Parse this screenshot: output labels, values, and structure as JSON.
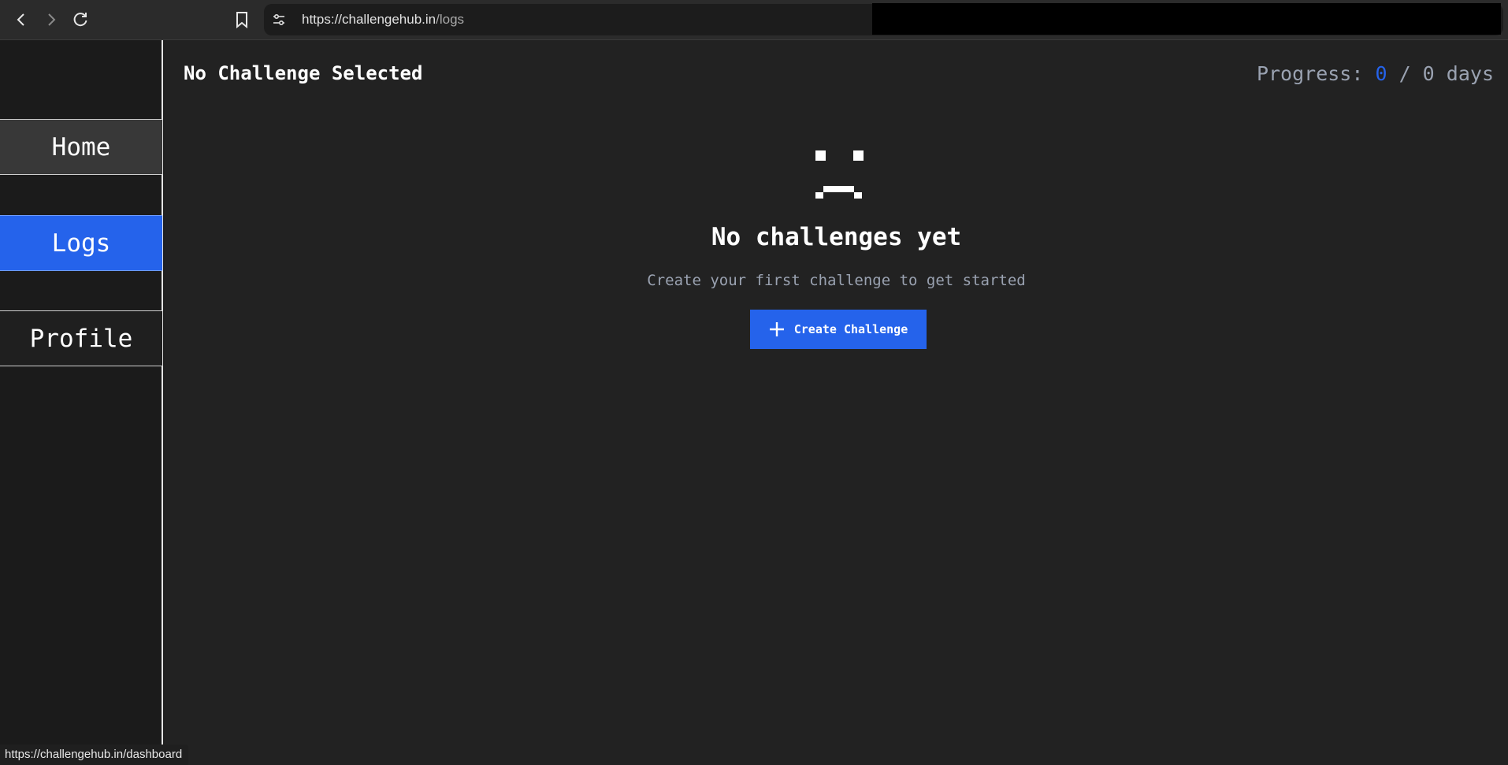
{
  "browser": {
    "url_host": "https://challengehub.in",
    "url_path": "/logs",
    "icons": [
      "back-icon",
      "forward-icon",
      "reload-icon",
      "bookmark-icon",
      "site-info-icon"
    ]
  },
  "sidebar": {
    "items": [
      {
        "label": "Home",
        "active": false
      },
      {
        "label": "Logs",
        "active": true
      },
      {
        "label": "Profile",
        "active": false
      }
    ]
  },
  "header": {
    "title": "No Challenge Selected",
    "progress_label": "Progress: ",
    "progress_current": "0",
    "progress_separator": " / 0 days"
  },
  "empty_state": {
    "title": "No challenges yet",
    "subtitle": "Create your first challenge to get started",
    "button_label": "Create Challenge"
  },
  "status_bar": {
    "link": "https://challengehub.in/dashboard"
  },
  "colors": {
    "accent": "#2563eb",
    "background": "#222222",
    "sidebar": "#1b1b1b"
  }
}
